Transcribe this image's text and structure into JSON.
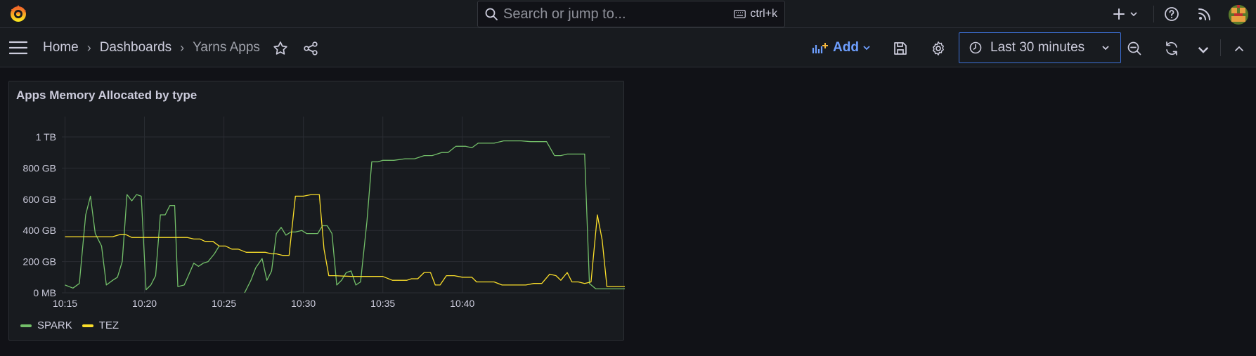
{
  "search": {
    "placeholder": "Search or jump to...",
    "shortcut": "ctrl+k"
  },
  "breadcrumb": {
    "home": "Home",
    "dashboards": "Dashboards",
    "current": "Yarns Apps"
  },
  "toolbar": {
    "add_label": "Add",
    "time_range": "Last 30 minutes"
  },
  "colors": {
    "spark": "#73bf69",
    "tez": "#fade2a",
    "accent": "#6e9fff"
  },
  "panel": {
    "title": "Apps Memory Allocated by type"
  },
  "chart_data": {
    "type": "line",
    "title": "Apps Memory Allocated by type",
    "xlabel": "",
    "ylabel": "",
    "y_unit": "GB",
    "ylim": [
      0,
      1100
    ],
    "xlim": [
      "10:15",
      "10:45"
    ],
    "x_ticks": [
      "10:15",
      "10:20",
      "10:25",
      "10:30",
      "10:35",
      "10:40"
    ],
    "y_ticks": [
      "0 MB",
      "200 GB",
      "400 GB",
      "600 GB",
      "800 GB",
      "1 TB"
    ],
    "y_tick_values": [
      0,
      200,
      400,
      600,
      800,
      1000
    ],
    "grid": true,
    "legend_position": "bottom-left",
    "series": [
      {
        "name": "SPARK",
        "points": [
          [
            "10:15",
            50
          ],
          [
            "10:15.5",
            30
          ],
          [
            "10:15.9",
            60
          ],
          [
            "10:16.3",
            500
          ],
          [
            "10:16.6",
            620
          ],
          [
            "10:16.9",
            380
          ],
          [
            "10:17.3",
            300
          ],
          [
            "10:17.6",
            50
          ],
          [
            "10:18",
            80
          ],
          [
            "10:18.3",
            100
          ],
          [
            "10:18.6",
            200
          ],
          [
            "10:18.9",
            630
          ],
          [
            "10:19.2",
            590
          ],
          [
            "10:19.5",
            630
          ],
          [
            "10:19.8",
            620
          ],
          [
            "10:20.1",
            20
          ],
          [
            "10:20.4",
            50
          ],
          [
            "10:20.7",
            110
          ],
          [
            "10:21",
            500
          ],
          [
            "10:21.3",
            500
          ],
          [
            "10:21.6",
            560
          ],
          [
            "10:21.9",
            560
          ],
          [
            "10:22.1",
            40
          ],
          [
            "10:22.5",
            50
          ],
          [
            "10:22.8",
            120
          ],
          [
            "10:23.1",
            190
          ],
          [
            "10:23.4",
            170
          ],
          [
            "10:23.7",
            190
          ],
          [
            "10:24",
            200
          ],
          [
            "10:24.4",
            250
          ],
          [
            "10:24.7",
            300
          ],
          [
            "10:25.0",
            null
          ],
          [
            "10:26.3",
            0
          ],
          [
            "10:26.7",
            80
          ],
          [
            "10:27",
            160
          ],
          [
            "10:27.4",
            220
          ],
          [
            "10:27.7",
            80
          ],
          [
            "10:28",
            140
          ],
          [
            "10:28.3",
            380
          ],
          [
            "10:28.6",
            420
          ],
          [
            "10:28.9",
            370
          ],
          [
            "10:29.2",
            390
          ],
          [
            "10:29.5",
            390
          ],
          [
            "10:29.9",
            400
          ],
          [
            "10:30.2",
            380
          ],
          [
            "10:30.6",
            380
          ],
          [
            "10:30.9",
            380
          ],
          [
            "10:31.2",
            430
          ],
          [
            "10:31.5",
            430
          ],
          [
            "10:31.8",
            380
          ],
          [
            "10:32.1",
            50
          ],
          [
            "10:32.4",
            80
          ],
          [
            "10:32.7",
            130
          ],
          [
            "10:33",
            140
          ],
          [
            "10:33.3",
            50
          ],
          [
            "10:33.6",
            70
          ],
          [
            "10:34",
            460
          ],
          [
            "10:34.3",
            840
          ],
          [
            "10:34.7",
            840
          ],
          [
            "10:35",
            850
          ],
          [
            "10:35.7",
            850
          ],
          [
            "10:36.4",
            860
          ],
          [
            "10:37",
            860
          ],
          [
            "10:37.6",
            880
          ],
          [
            "10:38.1",
            880
          ],
          [
            "10:38.7",
            900
          ],
          [
            "10:39.1",
            900
          ],
          [
            "10:39.6",
            940
          ],
          [
            "10:40.2",
            940
          ],
          [
            "10:40.6",
            930
          ],
          [
            "10:41",
            960
          ],
          [
            "10:41.5",
            960
          ],
          [
            "10:42",
            960
          ],
          [
            "10:42.6",
            975
          ],
          [
            "10:43.2",
            975
          ],
          [
            "10:43.7",
            975
          ],
          [
            "10:44.3",
            970
          ],
          [
            "10:44.8",
            970
          ],
          [
            "10:45.3",
            970
          ],
          [
            "10:45.8",
            880
          ],
          [
            "10:46.2",
            880
          ],
          [
            "10:46.6",
            890
          ],
          [
            "10:47.1",
            890
          ],
          [
            "10:47.7",
            890
          ],
          [
            "10:48",
            60
          ],
          [
            "10:48.4",
            25
          ],
          [
            "10:49",
            25
          ],
          [
            "10:50",
            25
          ],
          [
            "10:51",
            25
          ],
          [
            "10:52",
            25
          ]
        ]
      },
      {
        "name": "TEZ",
        "points": [
          [
            "10:15",
            360
          ],
          [
            "10:16",
            360
          ],
          [
            "10:17",
            360
          ],
          [
            "10:18",
            360
          ],
          [
            "10:18.5",
            375
          ],
          [
            "10:18.8",
            375
          ],
          [
            "10:19.2",
            355
          ],
          [
            "10:20",
            355
          ],
          [
            "10:21",
            355
          ],
          [
            "10:22",
            355
          ],
          [
            "10:22.7",
            355
          ],
          [
            "10:23.1",
            345
          ],
          [
            "10:23.5",
            345
          ],
          [
            "10:23.8",
            330
          ],
          [
            "10:24.3",
            330
          ],
          [
            "10:24.7",
            300
          ],
          [
            "10:25.1",
            300
          ],
          [
            "10:25.5",
            280
          ],
          [
            "10:25.9",
            280
          ],
          [
            "10:26.4",
            260
          ],
          [
            "10:27",
            260
          ],
          [
            "10:27.6",
            260
          ],
          [
            "10:28",
            250
          ],
          [
            "10:28.3",
            250
          ],
          [
            "10:28.7",
            240
          ],
          [
            "10:29.1",
            240
          ],
          [
            "10:29.5",
            620
          ],
          [
            "10:30",
            620
          ],
          [
            "10:30.5",
            630
          ],
          [
            "10:31",
            630
          ],
          [
            "10:31.3",
            280
          ],
          [
            "10:31.6",
            110
          ],
          [
            "10:32",
            110
          ],
          [
            "10:33",
            105
          ],
          [
            "10:34",
            105
          ],
          [
            "10:35",
            105
          ],
          [
            "10:35.6",
            80
          ],
          [
            "10:36.1",
            80
          ],
          [
            "10:36.5",
            80
          ],
          [
            "10:36.8",
            90
          ],
          [
            "10:37.2",
            90
          ],
          [
            "10:37.6",
            130
          ],
          [
            "10:38",
            130
          ],
          [
            "10:38.3",
            50
          ],
          [
            "10:38.6",
            50
          ],
          [
            "10:39",
            110
          ],
          [
            "10:39.5",
            110
          ],
          [
            "10:40",
            100
          ],
          [
            "10:40.6",
            100
          ],
          [
            "10:40.9",
            70
          ],
          [
            "10:41.3",
            70
          ],
          [
            "10:42",
            70
          ],
          [
            "10:42.5",
            50
          ],
          [
            "10:43",
            50
          ],
          [
            "10:43.5",
            50
          ],
          [
            "10:44",
            50
          ],
          [
            "10:44.5",
            60
          ],
          [
            "10:45",
            60
          ],
          [
            "10:45.5",
            120
          ],
          [
            "10:45.9",
            110
          ],
          [
            "10:46.2",
            80
          ],
          [
            "10:46.6",
            130
          ],
          [
            "10:46.9",
            70
          ],
          [
            "10:47.3",
            70
          ],
          [
            "10:47.7",
            60
          ],
          [
            "10:48.1",
            70
          ],
          [
            "10:48.5",
            500
          ],
          [
            "10:48.8",
            340
          ],
          [
            "10:49.1",
            40
          ],
          [
            "10:49.5",
            40
          ],
          [
            "10:50",
            40
          ],
          [
            "10:51",
            40
          ],
          [
            "10:52",
            40
          ]
        ]
      }
    ]
  }
}
